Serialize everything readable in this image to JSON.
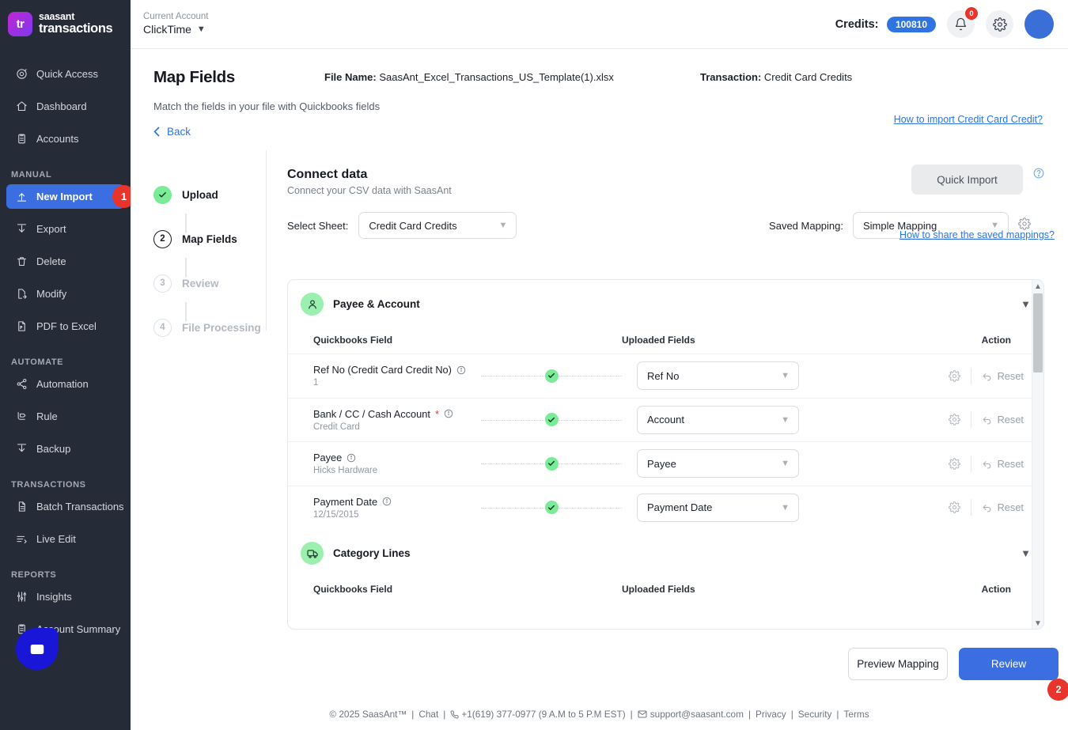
{
  "brand": {
    "line1": "saasant",
    "line2": "transactions",
    "logo_text": "tr"
  },
  "account": {
    "label": "Current Account",
    "value": "ClickTime"
  },
  "header": {
    "credits_label": "Credits:",
    "credits_value": "100810",
    "notifications_badge": "0",
    "bell_icon": "bell-icon",
    "gear_icon": "gear-icon",
    "avatar": "user-avatar"
  },
  "sidebar": {
    "groups": [
      {
        "title": "",
        "items": [
          {
            "label": "Quick Access",
            "icon": "target-icon",
            "active": false
          },
          {
            "label": "Dashboard",
            "icon": "home-icon",
            "active": false
          },
          {
            "label": "Accounts",
            "icon": "clipboard-icon",
            "active": false
          }
        ]
      },
      {
        "title": "MANUAL",
        "items": [
          {
            "label": "New Import",
            "icon": "upload-icon",
            "active": true,
            "badge": "1"
          },
          {
            "label": "Export",
            "icon": "download-icon",
            "active": false
          },
          {
            "label": "Delete",
            "icon": "trash-icon",
            "active": false
          },
          {
            "label": "Modify",
            "icon": "file-edit-icon",
            "active": false
          },
          {
            "label": "PDF to Excel",
            "icon": "pdf-icon",
            "active": false
          }
        ]
      },
      {
        "title": "AUTOMATE",
        "items": [
          {
            "label": "Automation",
            "icon": "share-nodes-icon",
            "active": false
          },
          {
            "label": "Rule",
            "icon": "rule-icon",
            "active": false
          },
          {
            "label": "Backup",
            "icon": "backup-icon",
            "active": false
          }
        ]
      },
      {
        "title": "TRANSACTIONS",
        "items": [
          {
            "label": "Batch Transactions",
            "icon": "document-icon",
            "active": false
          },
          {
            "label": "Live Edit",
            "icon": "lines-icon",
            "active": false
          }
        ]
      },
      {
        "title": "REPORTS",
        "items": [
          {
            "label": "Insights",
            "icon": "sliders-icon",
            "active": false
          },
          {
            "label": "Account Summary",
            "icon": "clipboard-icon",
            "active": false
          }
        ]
      }
    ],
    "chat_icon": "chat-icon"
  },
  "page": {
    "title": "Map Fields",
    "file_name_label": "File Name:",
    "file_name_value": "SaasAnt_Excel_Transactions_US_Template(1).xlsx",
    "transaction_label": "Transaction:",
    "transaction_value": "Credit Card Credits",
    "subtitle": "Match the fields in your file with Quickbooks fields",
    "howto_link": "How to import Credit Card Credit?",
    "back_label": "Back"
  },
  "stepper": [
    {
      "num": "1",
      "label": "Upload",
      "state": "done"
    },
    {
      "num": "2",
      "label": "Map Fields",
      "state": "current"
    },
    {
      "num": "3",
      "label": "Review",
      "state": "todo"
    },
    {
      "num": "4",
      "label": "File Processing",
      "state": "todo"
    }
  ],
  "connect": {
    "title": "Connect data",
    "subtitle": "Connect your CSV data with SaasAnt",
    "quick_import_label": "Quick Import",
    "help_icon": "help-circle-icon",
    "select_sheet_label": "Select Sheet:",
    "select_sheet_value": "Credit Card Credits",
    "saved_mapping_label": "Saved Mapping:",
    "saved_mapping_value": "Simple Mapping",
    "mapping_settings_icon": "gear-icon",
    "share_link": "How to share the saved mappings?"
  },
  "table": {
    "col_quickbooks": "Quickbooks Field",
    "col_uploaded": "Uploaded Fields",
    "col_action": "Action",
    "reset_label": "Reset",
    "gear_icon": "gear-icon",
    "reset_icon": "undo-icon"
  },
  "sections": [
    {
      "title": "Payee & Account",
      "icon": "person-icon",
      "rows": [
        {
          "field": "Ref No (Credit Card Credit No)",
          "required": false,
          "sample": "1",
          "mapped": "Ref No",
          "status": "matched"
        },
        {
          "field": "Bank / CC / Cash Account",
          "required": true,
          "sample": "Credit Card",
          "mapped": "Account",
          "status": "matched"
        },
        {
          "field": "Payee",
          "required": false,
          "sample": "Hicks Hardware",
          "mapped": "Payee",
          "status": "matched"
        },
        {
          "field": "Payment Date",
          "required": false,
          "sample": "12/15/2015",
          "mapped": "Payment Date",
          "status": "matched"
        }
      ]
    },
    {
      "title": "Category Lines",
      "icon": "truck-icon",
      "rows": []
    }
  ],
  "footer_actions": {
    "preview_label": "Preview Mapping",
    "review_label": "Review",
    "review_badge": "2"
  },
  "footer": {
    "copyright": "© 2025 SaasAnt™",
    "chat": "Chat",
    "phone": "+1(619) 377-0977 (9 A.M to 5 P.M EST)",
    "email": "support@saasant.com",
    "privacy": "Privacy",
    "security": "Security",
    "terms": "Terms"
  },
  "colors": {
    "accent_blue": "#3b6ee0",
    "sidebar_bg": "#262b38",
    "success_green": "#7aeb96",
    "danger_red": "#e8342a"
  }
}
